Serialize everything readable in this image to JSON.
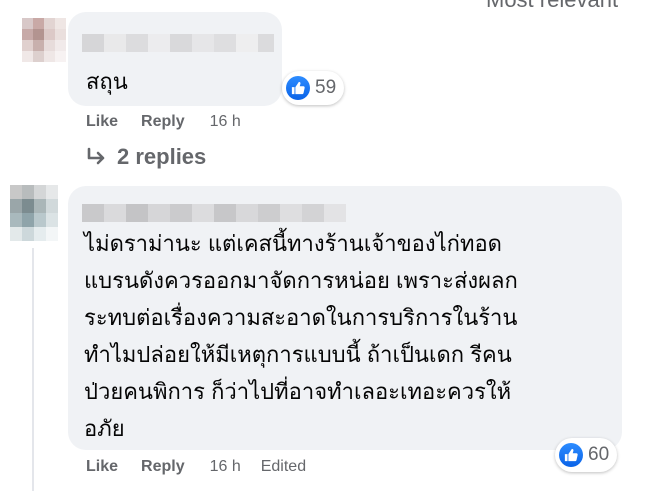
{
  "header": {
    "sort_label": "Most relevant"
  },
  "comments": [
    {
      "text_lines": [
        "สถุน"
      ],
      "reaction_count": "59",
      "actions": {
        "like": "Like",
        "reply": "Reply",
        "time": "16 h"
      },
      "replies_label": "2 replies"
    },
    {
      "text_lines": [
        "ไม่ดราม่านะ แต่เคสนี้ทางร้านเจ้าของไก่ทอด",
        "แบรนดังควรออกมาจัดการหน่อย เพราะส่งผลก",
        "ระทบต่อเรื่องความสะอาดในการบริการในร้าน",
        "ทำไมปล่อยให้มีเหตุการแบบนี้ ถ้าเป็นเดก รีคน",
        "ป่วยคนพิการ ก็ว่าไปที่อาจทำเลอะเทอะควรให้",
        "อภัย"
      ],
      "reaction_count": "60",
      "actions": {
        "like": "Like",
        "reply": "Reply",
        "time": "16 h",
        "edited": "Edited"
      }
    }
  ],
  "colors": {
    "bubble": "#f0f2f5",
    "meta_text": "#65676b",
    "like_blue": "#1877f2"
  },
  "icons": [
    "like-icon",
    "reply-arrow-icon"
  ]
}
